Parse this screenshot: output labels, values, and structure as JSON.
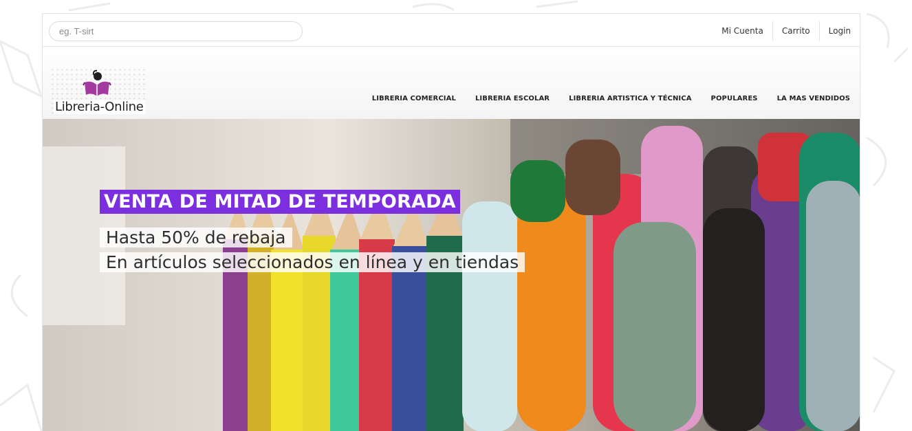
{
  "search": {
    "placeholder": "eg. T-sirt"
  },
  "top_links": [
    "Mi Cuenta",
    "Carrito",
    "Login"
  ],
  "logo": {
    "text": "Libreria-Online"
  },
  "nav": [
    "LIBRERIA COMERCIAL",
    "LIBRERIA ESCOLAR",
    "LIBRERIA ARTISTICA Y TÉCNICA",
    "POPULARES",
    "LA MAS VENDIDOS"
  ],
  "hero": {
    "title": "VENTA DE MITAD DE TEMPORADA",
    "line1": "Hasta 50% de rebaja",
    "line2": "En artículos seleccionados en línea y en tiendas"
  },
  "colors": {
    "accent": "#7b2fde"
  }
}
